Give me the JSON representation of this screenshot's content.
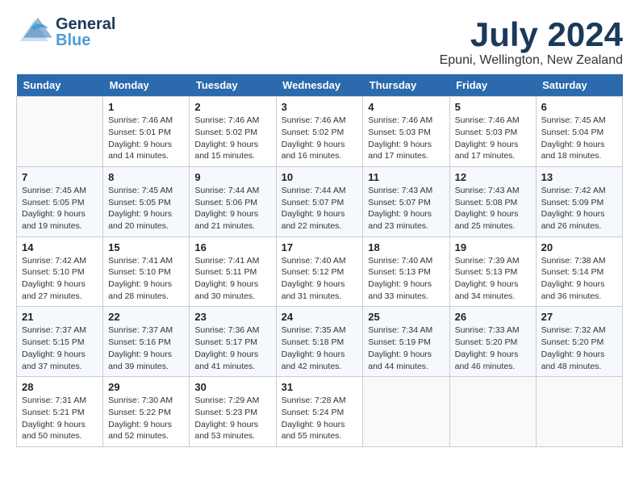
{
  "header": {
    "logo_general": "General",
    "logo_blue": "Blue",
    "month_year": "July 2024",
    "location": "Epuni, Wellington, New Zealand"
  },
  "weekdays": [
    "Sunday",
    "Monday",
    "Tuesday",
    "Wednesday",
    "Thursday",
    "Friday",
    "Saturday"
  ],
  "weeks": [
    [
      {
        "day": "",
        "info": ""
      },
      {
        "day": "1",
        "info": "Sunrise: 7:46 AM\nSunset: 5:01 PM\nDaylight: 9 hours\nand 14 minutes."
      },
      {
        "day": "2",
        "info": "Sunrise: 7:46 AM\nSunset: 5:02 PM\nDaylight: 9 hours\nand 15 minutes."
      },
      {
        "day": "3",
        "info": "Sunrise: 7:46 AM\nSunset: 5:02 PM\nDaylight: 9 hours\nand 16 minutes."
      },
      {
        "day": "4",
        "info": "Sunrise: 7:46 AM\nSunset: 5:03 PM\nDaylight: 9 hours\nand 17 minutes."
      },
      {
        "day": "5",
        "info": "Sunrise: 7:46 AM\nSunset: 5:03 PM\nDaylight: 9 hours\nand 17 minutes."
      },
      {
        "day": "6",
        "info": "Sunrise: 7:45 AM\nSunset: 5:04 PM\nDaylight: 9 hours\nand 18 minutes."
      }
    ],
    [
      {
        "day": "7",
        "info": "Sunrise: 7:45 AM\nSunset: 5:05 PM\nDaylight: 9 hours\nand 19 minutes."
      },
      {
        "day": "8",
        "info": "Sunrise: 7:45 AM\nSunset: 5:05 PM\nDaylight: 9 hours\nand 20 minutes."
      },
      {
        "day": "9",
        "info": "Sunrise: 7:44 AM\nSunset: 5:06 PM\nDaylight: 9 hours\nand 21 minutes."
      },
      {
        "day": "10",
        "info": "Sunrise: 7:44 AM\nSunset: 5:07 PM\nDaylight: 9 hours\nand 22 minutes."
      },
      {
        "day": "11",
        "info": "Sunrise: 7:43 AM\nSunset: 5:07 PM\nDaylight: 9 hours\nand 23 minutes."
      },
      {
        "day": "12",
        "info": "Sunrise: 7:43 AM\nSunset: 5:08 PM\nDaylight: 9 hours\nand 25 minutes."
      },
      {
        "day": "13",
        "info": "Sunrise: 7:42 AM\nSunset: 5:09 PM\nDaylight: 9 hours\nand 26 minutes."
      }
    ],
    [
      {
        "day": "14",
        "info": "Sunrise: 7:42 AM\nSunset: 5:10 PM\nDaylight: 9 hours\nand 27 minutes."
      },
      {
        "day": "15",
        "info": "Sunrise: 7:41 AM\nSunset: 5:10 PM\nDaylight: 9 hours\nand 28 minutes."
      },
      {
        "day": "16",
        "info": "Sunrise: 7:41 AM\nSunset: 5:11 PM\nDaylight: 9 hours\nand 30 minutes."
      },
      {
        "day": "17",
        "info": "Sunrise: 7:40 AM\nSunset: 5:12 PM\nDaylight: 9 hours\nand 31 minutes."
      },
      {
        "day": "18",
        "info": "Sunrise: 7:40 AM\nSunset: 5:13 PM\nDaylight: 9 hours\nand 33 minutes."
      },
      {
        "day": "19",
        "info": "Sunrise: 7:39 AM\nSunset: 5:13 PM\nDaylight: 9 hours\nand 34 minutes."
      },
      {
        "day": "20",
        "info": "Sunrise: 7:38 AM\nSunset: 5:14 PM\nDaylight: 9 hours\nand 36 minutes."
      }
    ],
    [
      {
        "day": "21",
        "info": "Sunrise: 7:37 AM\nSunset: 5:15 PM\nDaylight: 9 hours\nand 37 minutes."
      },
      {
        "day": "22",
        "info": "Sunrise: 7:37 AM\nSunset: 5:16 PM\nDaylight: 9 hours\nand 39 minutes."
      },
      {
        "day": "23",
        "info": "Sunrise: 7:36 AM\nSunset: 5:17 PM\nDaylight: 9 hours\nand 41 minutes."
      },
      {
        "day": "24",
        "info": "Sunrise: 7:35 AM\nSunset: 5:18 PM\nDaylight: 9 hours\nand 42 minutes."
      },
      {
        "day": "25",
        "info": "Sunrise: 7:34 AM\nSunset: 5:19 PM\nDaylight: 9 hours\nand 44 minutes."
      },
      {
        "day": "26",
        "info": "Sunrise: 7:33 AM\nSunset: 5:20 PM\nDaylight: 9 hours\nand 46 minutes."
      },
      {
        "day": "27",
        "info": "Sunrise: 7:32 AM\nSunset: 5:20 PM\nDaylight: 9 hours\nand 48 minutes."
      }
    ],
    [
      {
        "day": "28",
        "info": "Sunrise: 7:31 AM\nSunset: 5:21 PM\nDaylight: 9 hours\nand 50 minutes."
      },
      {
        "day": "29",
        "info": "Sunrise: 7:30 AM\nSunset: 5:22 PM\nDaylight: 9 hours\nand 52 minutes."
      },
      {
        "day": "30",
        "info": "Sunrise: 7:29 AM\nSunset: 5:23 PM\nDaylight: 9 hours\nand 53 minutes."
      },
      {
        "day": "31",
        "info": "Sunrise: 7:28 AM\nSunset: 5:24 PM\nDaylight: 9 hours\nand 55 minutes."
      },
      {
        "day": "",
        "info": ""
      },
      {
        "day": "",
        "info": ""
      },
      {
        "day": "",
        "info": ""
      }
    ]
  ]
}
